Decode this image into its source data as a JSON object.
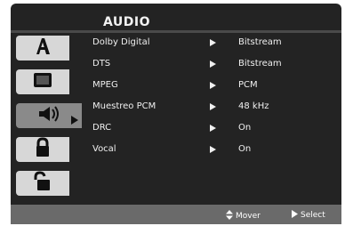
{
  "header": {
    "title": "AUDIO"
  },
  "sidebar": {
    "tabs": [
      {
        "icon": "font-letter-a-icon",
        "active": false
      },
      {
        "icon": "display-screen-icon",
        "active": false
      },
      {
        "icon": "speaker-icon",
        "active": true
      },
      {
        "icon": "lock-closed-icon",
        "active": false
      },
      {
        "icon": "lock-open-icon",
        "active": false
      }
    ]
  },
  "settings": [
    {
      "label": "Dolby Digital",
      "value": "Bitstream"
    },
    {
      "label": "DTS",
      "value": "Bitstream"
    },
    {
      "label": "MPEG",
      "value": "PCM"
    },
    {
      "label": "Muestreo PCM",
      "value": "48 kHz"
    },
    {
      "label": "DRC",
      "value": "On"
    },
    {
      "label": "Vocal",
      "value": "On"
    }
  ],
  "footer": {
    "move_label": "Mover",
    "select_label": "Select"
  }
}
